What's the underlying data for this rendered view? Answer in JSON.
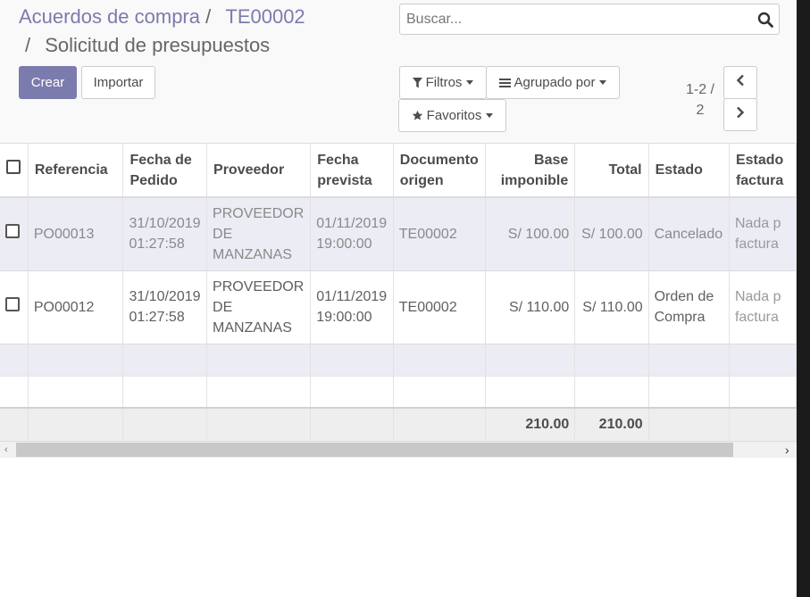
{
  "breadcrumb": {
    "item1": "Acuerdos de compra",
    "sep1": "/",
    "item2": "TE00002",
    "sep2": "/",
    "current": "Solicitud de presupuestos"
  },
  "buttons": {
    "create": "Crear",
    "import": "Importar"
  },
  "search": {
    "placeholder": "Buscar..."
  },
  "filters": {
    "filters_label": "Filtros",
    "groupby_label": "Agrupado por",
    "favorites_label": "Favoritos"
  },
  "pager": {
    "range": "1-2 /",
    "total": "2"
  },
  "table": {
    "headers": {
      "reference": "Referencia",
      "order_date": [
        "Fecha de",
        "Pedido"
      ],
      "vendor": "Proveedor",
      "planned_date": [
        "Fecha",
        "prevista"
      ],
      "origin": [
        "Documento",
        "origen"
      ],
      "untaxed": [
        "Base",
        "imponible"
      ],
      "total": "Total",
      "state": "Estado",
      "invoice_state": [
        "Estado",
        "factura"
      ]
    },
    "rows": [
      {
        "reference": "PO00013",
        "order_date": [
          "31/10/2019",
          "01:27:58"
        ],
        "vendor": [
          "PROVEEDOR",
          "DE",
          "MANZANAS"
        ],
        "planned_date": [
          "01/11/2019",
          "19:00:00"
        ],
        "origin": "TE00002",
        "untaxed": "S/ 100.00",
        "total": "S/ 100.00",
        "state": "Cancelado",
        "invoice_state": [
          "Nada p",
          "factura"
        ]
      },
      {
        "reference": "PO00012",
        "order_date": [
          "31/10/2019",
          "01:27:58"
        ],
        "vendor": [
          "PROVEEDOR",
          "DE",
          "MANZANAS"
        ],
        "planned_date": [
          "01/11/2019",
          "19:00:00"
        ],
        "origin": "TE00002",
        "untaxed": "S/ 110.00",
        "total": "S/ 110.00",
        "state": [
          "Orden de",
          "Compra"
        ],
        "invoice_state": [
          "Nada p",
          "factura"
        ]
      }
    ],
    "footer": {
      "untaxed_sum": "210.00",
      "total_sum": "210.00"
    }
  },
  "icons": {
    "search": "search-icon",
    "filter": "filter-icon",
    "groupby": "bars-icon",
    "favorites": "star-icon",
    "prev": "chevron-left-icon",
    "next": "chevron-right-icon"
  },
  "colors": {
    "primary": "#7c7bad",
    "row_highlight": "#ececf5"
  }
}
